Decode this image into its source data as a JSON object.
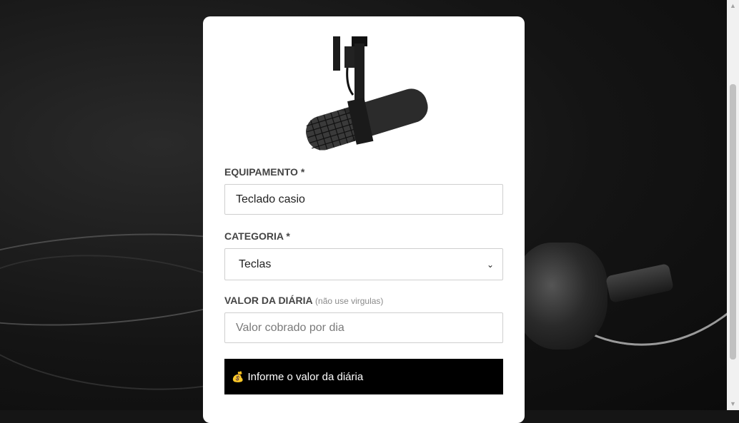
{
  "form": {
    "equipamento": {
      "label": "EQUIPAMENTO *",
      "value": "Teclado casio"
    },
    "categoria": {
      "label": "CATEGORIA *",
      "selected": "Teclas"
    },
    "valor": {
      "label": "VALOR DA DIÁRIA",
      "hint": "(não use virgulas)",
      "placeholder": "Valor cobrado por dia"
    },
    "submit": {
      "icon": "money-bag-icon",
      "emoji": "💰",
      "label": "Informe o valor da diária"
    }
  },
  "colors": {
    "button_bg": "#000000",
    "card_bg": "#ffffff",
    "label": "#444444"
  }
}
